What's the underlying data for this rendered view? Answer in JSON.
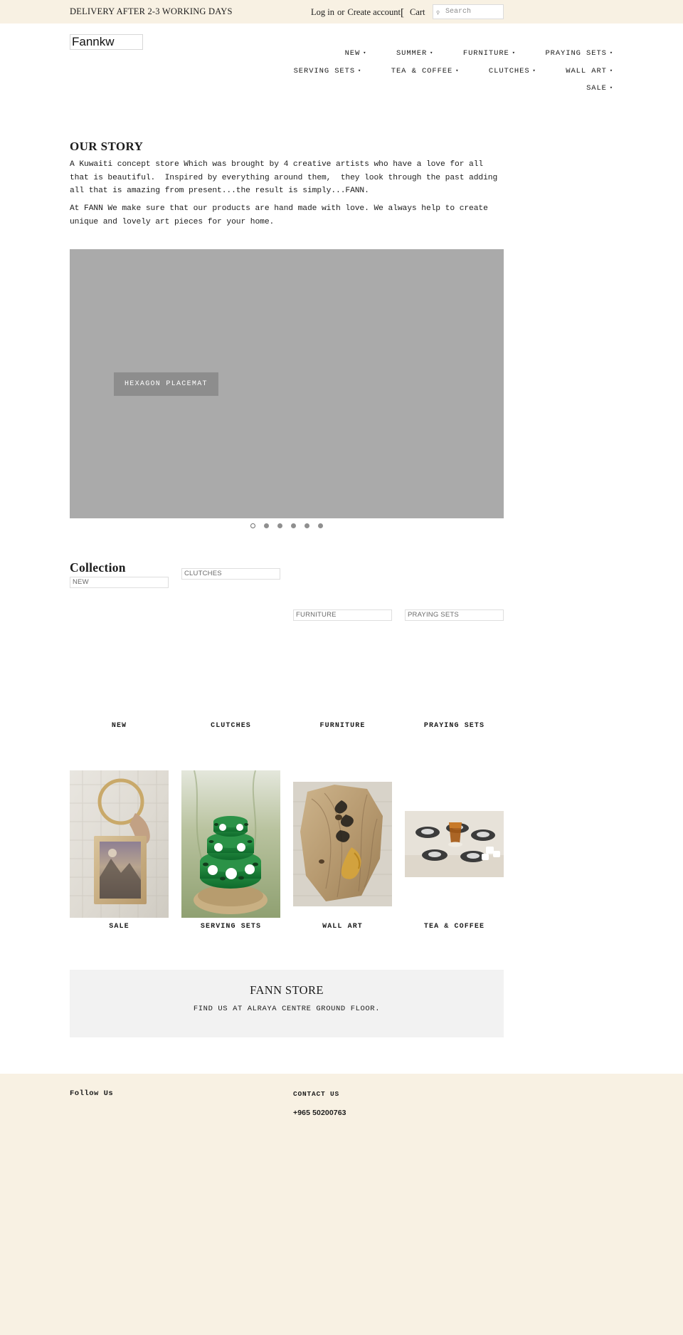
{
  "topbar": {
    "delivery_notice": "DELIVERY AFTER 2-3 WORKING DAYS",
    "login_label": "Log in",
    "or_label": "or",
    "create_account_label": "Create account",
    "cart_label": "Cart",
    "cart_icon_glyph": "[",
    "search_placeholder": "Search",
    "search_value": "",
    "background_color": "#f8f1e3"
  },
  "header": {
    "logo_text": "Fannkw",
    "nav_rows": [
      [
        {
          "label": "NEW",
          "caret": "▾"
        },
        {
          "label": "SUMMER",
          "caret": "▾"
        },
        {
          "label": "FURNITURE",
          "caret": "▾"
        },
        {
          "label": "PRAYING SETS",
          "caret": "▾"
        }
      ],
      [
        {
          "label": "SERVING SETS",
          "caret": "▾"
        },
        {
          "label": "TEA & COFFEE",
          "caret": "▾"
        },
        {
          "label": "CLUTCHES",
          "caret": "▾"
        },
        {
          "label": "WALL ART",
          "caret": "▾"
        }
      ],
      [
        {
          "label": "SALE",
          "caret": "▾"
        }
      ]
    ]
  },
  "our_story": {
    "title": "OUR STORY",
    "paragraph_1": "A Kuwaiti concept store Which was brought by 4 creative artists who have a love for all that is beautiful.  Inspired by everything around them,  they look through the past adding all that is amazing from present...the result is simply...FANN.",
    "paragraph_2": "At FANN We make sure that our products are hand made with love. We always help to create unique and lovely art pieces for your home."
  },
  "hero": {
    "caption": "HEXAGON PLACEMAT",
    "slide_count": 6,
    "active_slide": 1,
    "background_color": "#aaaaaa"
  },
  "collection": {
    "title": "Collection",
    "row1": [
      {
        "alt_text": "NEW",
        "label": "NEW"
      },
      {
        "alt_text": "CLUTCHES",
        "label": "CLUTCHES"
      },
      {
        "alt_text": "FURNITURE",
        "label": "FURNITURE"
      },
      {
        "alt_text": "PRAYING SETS",
        "label": "PRAYING SETS"
      }
    ],
    "row2": [
      {
        "label": "SALE"
      },
      {
        "label": "SERVING SETS"
      },
      {
        "label": "WALL ART"
      },
      {
        "label": "TEA & COFFEE"
      }
    ]
  },
  "store_band": {
    "title": "FANN STORE",
    "subtitle": "FIND US AT ALRAYA CENTRE GROUND FLOOR.",
    "background_color": "#f2f2f2"
  },
  "footer": {
    "follow_us_heading": "Follow Us",
    "contact_heading": "CONTACT US",
    "phone": "+965 50200763",
    "background_color": "#f8f1e3"
  }
}
